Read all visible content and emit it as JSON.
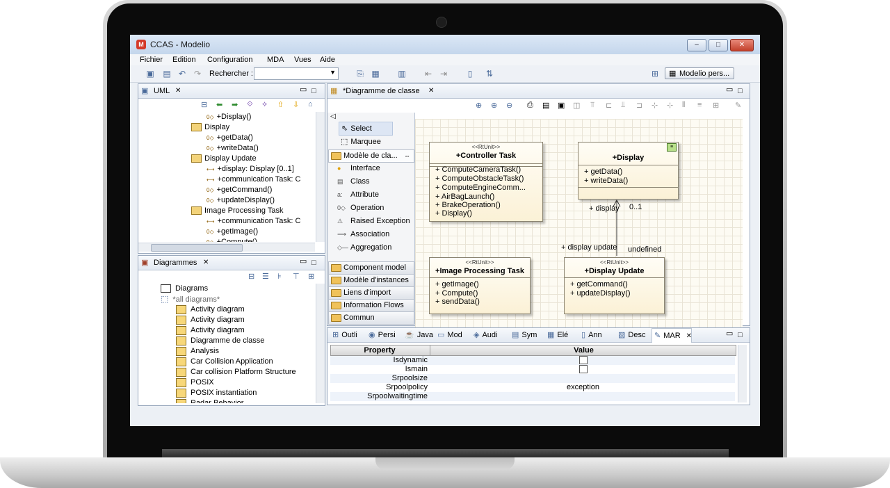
{
  "window": {
    "title": "CCAS - Modelio",
    "app_icon": "M"
  },
  "menu": [
    "Fichier",
    "Edition",
    "Configuration",
    "MDA",
    "Vues",
    "Aide"
  ],
  "toolbar": {
    "search_label": "Rechercher :",
    "search_value": "",
    "perspective": "Modelio pers..."
  },
  "uml_panel": {
    "tab": "UML",
    "rows": [
      {
        "indent": 3,
        "icon": "op",
        "text": "+Display()"
      },
      {
        "indent": 2,
        "icon": "class",
        "text": "Display"
      },
      {
        "indent": 3,
        "icon": "op",
        "text": "+getData()"
      },
      {
        "indent": 3,
        "icon": "op",
        "text": "+writeData()"
      },
      {
        "indent": 2,
        "icon": "class",
        "text": "Display Update"
      },
      {
        "indent": 3,
        "icon": "assoc",
        "text": "+display: Display [0..1]"
      },
      {
        "indent": 3,
        "icon": "assoc",
        "text": "+communication Task: C"
      },
      {
        "indent": 3,
        "icon": "op",
        "text": "+getCommand()"
      },
      {
        "indent": 3,
        "icon": "op",
        "text": "+updateDisplay()"
      },
      {
        "indent": 2,
        "icon": "class",
        "text": "Image Processing Task"
      },
      {
        "indent": 3,
        "icon": "assoc",
        "text": "+communication Task: C"
      },
      {
        "indent": 3,
        "icon": "op",
        "text": "+getImage()"
      },
      {
        "indent": 3,
        "icon": "op",
        "text": "+Compute()"
      }
    ]
  },
  "diagram_panel": {
    "tab": "Diagrammes",
    "rows": [
      {
        "indent": 1,
        "icon": "folder",
        "text": "Diagrams"
      },
      {
        "indent": 1,
        "icon": "folder-open",
        "text": "*all diagrams*"
      },
      {
        "indent": 2,
        "icon": "activity",
        "text": "Activity diagram"
      },
      {
        "indent": 2,
        "icon": "activity",
        "text": "Activity diagram"
      },
      {
        "indent": 2,
        "icon": "activity",
        "text": "Activity diagram"
      },
      {
        "indent": 2,
        "icon": "class-diagram",
        "text": "Diagramme de classe"
      },
      {
        "indent": 2,
        "icon": "analysis",
        "text": "Analysis"
      },
      {
        "indent": 2,
        "icon": "class-diagram",
        "text": "Car Collision Application"
      },
      {
        "indent": 2,
        "icon": "class-diagram",
        "text": "Car collision Platform Structure"
      },
      {
        "indent": 2,
        "icon": "class-diagram",
        "text": "POSIX"
      },
      {
        "indent": 2,
        "icon": "class-diagram",
        "text": "POSIX instantiation"
      },
      {
        "indent": 2,
        "icon": "activity",
        "text": "Radar Behavior"
      }
    ]
  },
  "editor": {
    "tab": "*Diagramme de classe",
    "palette": {
      "tools": [
        "Select",
        "Marquee"
      ],
      "group_open": "Modèle de cla...",
      "items": [
        "Interface",
        "Class",
        "Attribute",
        "Operation",
        "Raised Exception",
        "Association",
        "Aggregation"
      ],
      "groups": [
        "Component model",
        "Modèle d'instances",
        "Liens d'import",
        "Information Flows",
        "Commun"
      ]
    },
    "boxes": [
      {
        "id": "controller",
        "stereotype": "<<RtUnit>>",
        "name": "+Controller Task",
        "ops": [
          "+ ComputeCameraTask()",
          "+ ComputeObstacleTask()",
          "+ ComputeEngineComm...",
          "+ AirBagLaunch()",
          "+ BrakeOperation()",
          "+ Display()"
        ]
      },
      {
        "id": "display",
        "stereotype": "",
        "name": "+Display",
        "ops": [
          "+ getData()",
          "+ writeData()"
        ]
      },
      {
        "id": "image",
        "stereotype": "<<RtUnit>>",
        "name": "+Image Processing Task",
        "ops": [
          "+ getImage()",
          "+ Compute()",
          "+ sendData()"
        ]
      },
      {
        "id": "update",
        "stereotype": "<<RtUnit>>",
        "name": "+Display Update",
        "ops": [
          "+ getCommand()",
          "+ updateDisplay()"
        ]
      }
    ],
    "labels": {
      "role_display": "+ display",
      "mult": "0..1",
      "role_update": "+ display update",
      "undefined": "undefined"
    }
  },
  "properties": {
    "tabs": [
      "Outli",
      "Persi",
      "Java",
      "Mod",
      "Audi",
      "Sym",
      "Elé",
      "Ann",
      "Desc",
      "MAR"
    ],
    "header": [
      "Property",
      "Value"
    ],
    "rows": [
      {
        "name": "Isdynamic",
        "value": "",
        "checkbox": true
      },
      {
        "name": "Ismain",
        "value": "",
        "checkbox": true
      },
      {
        "name": "Srpoolsize",
        "value": "",
        "checkbox": false
      },
      {
        "name": "Srpoolpolicy",
        "value": "exception",
        "checkbox": false
      },
      {
        "name": "Srpoolwaitingtime",
        "value": "",
        "checkbox": false
      }
    ]
  },
  "colors": {
    "accent": "#4a6a9a",
    "close": "#c2402b",
    "class_fill": "#fbf1d6"
  }
}
